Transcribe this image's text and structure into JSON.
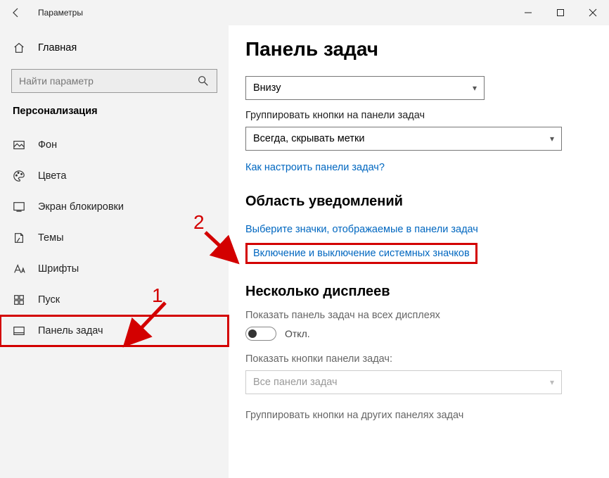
{
  "titlebar": {
    "title": "Параметры"
  },
  "sidebar": {
    "home": "Главная",
    "search_placeholder": "Найти параметр",
    "section": "Персонализация",
    "items": [
      {
        "label": "Фон"
      },
      {
        "label": "Цвета"
      },
      {
        "label": "Экран блокировки"
      },
      {
        "label": "Темы"
      },
      {
        "label": "Шрифты"
      },
      {
        "label": "Пуск"
      },
      {
        "label": "Панель задач"
      }
    ]
  },
  "main": {
    "title": "Панель задач",
    "position_value": "Внизу",
    "group_label": "Группировать кнопки на панели задач",
    "group_value": "Всегда, скрывать метки",
    "help_link": "Как настроить панели задач?",
    "notif_heading": "Область уведомлений",
    "notif_link1": "Выберите значки, отображаемые в панели задач",
    "notif_link2": "Включение и выключение системных значков",
    "multi_heading": "Несколько дисплеев",
    "multi_show_label": "Показать панель задач на всех дисплеях",
    "toggle_off": "Откл.",
    "multi_buttons_label": "Показать кнопки панели задач:",
    "multi_buttons_value": "Все панели задач",
    "multi_group_label": "Группировать кнопки на других панелях задач"
  },
  "annotations": {
    "n1": "1",
    "n2": "2"
  }
}
